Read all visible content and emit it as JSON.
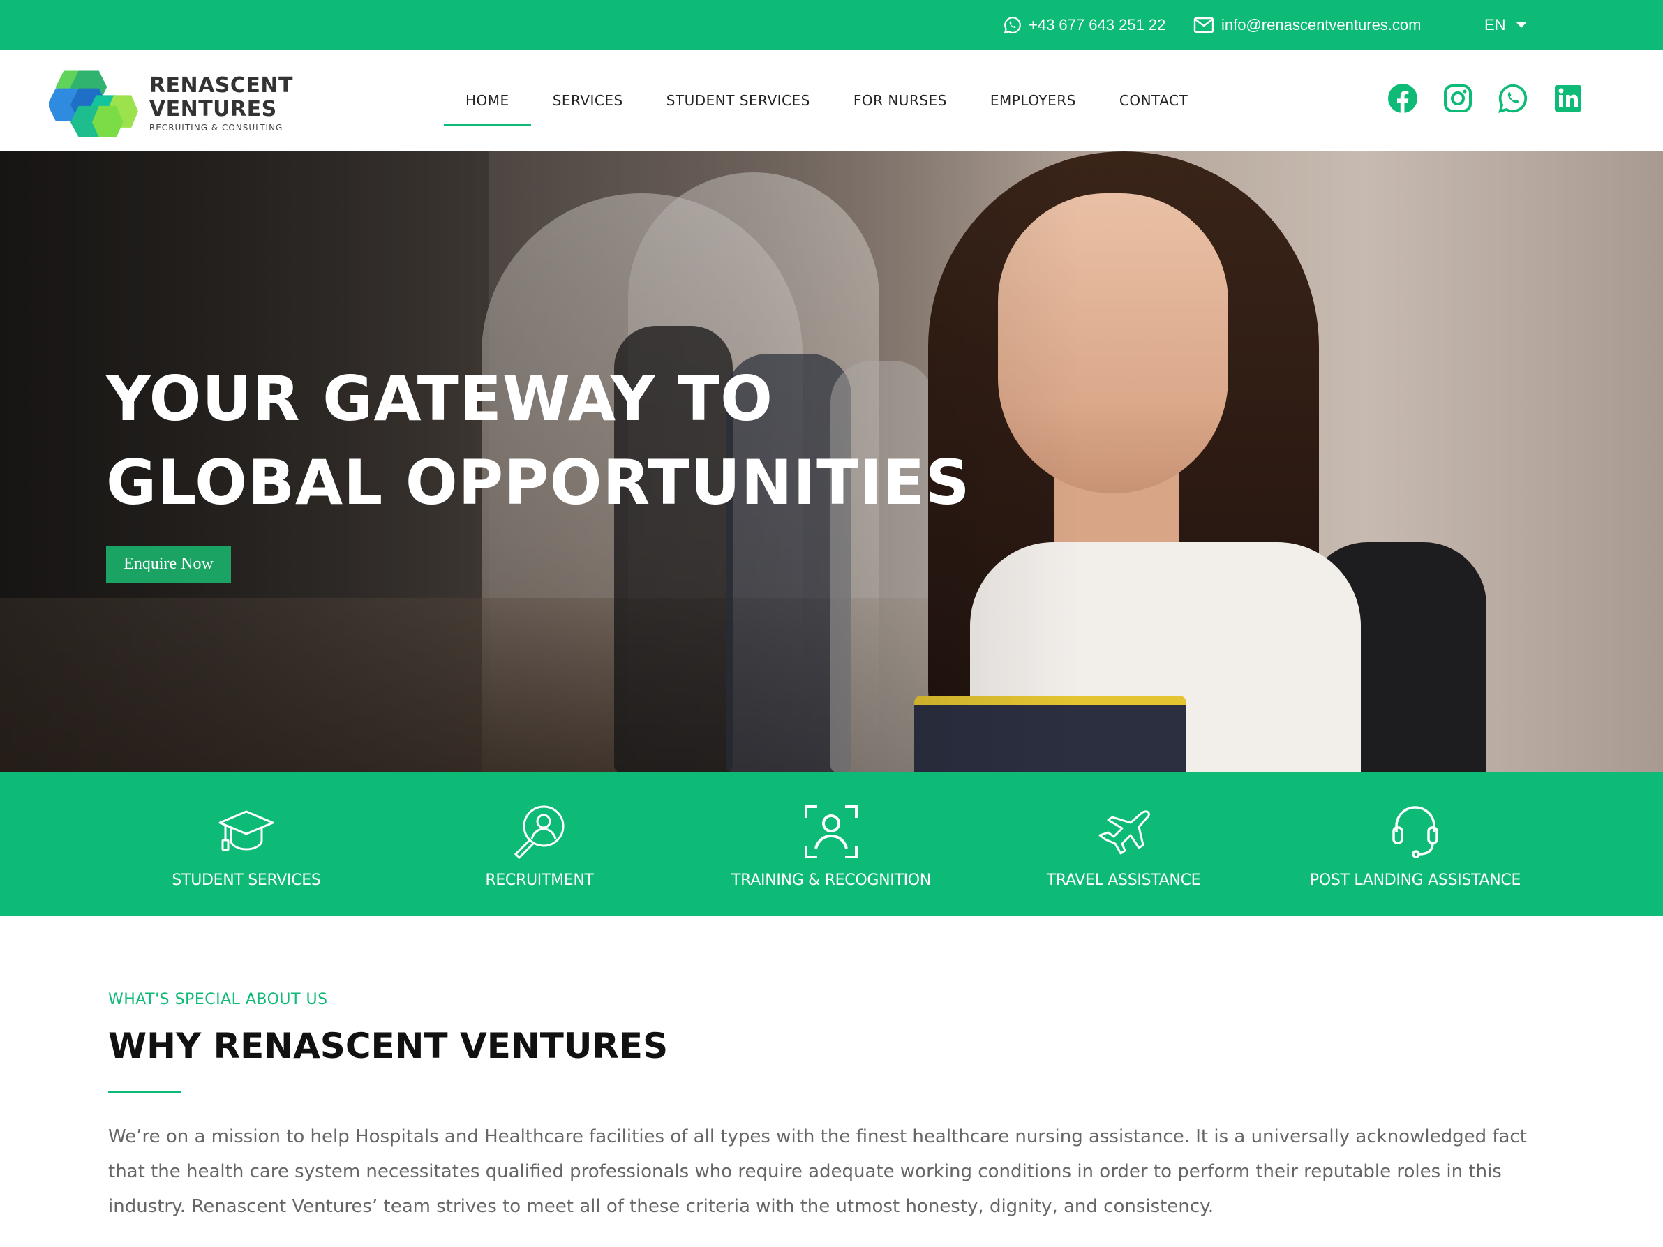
{
  "topbar": {
    "phone": "+43 677 643 251 22",
    "email": "info@renascentventures.com",
    "language": "EN",
    "background": "#0dba76"
  },
  "logo": {
    "line1": "RENASCENT",
    "line2": "VENTURES",
    "tagline": "RECRUITING & CONSULTING"
  },
  "nav": {
    "items": [
      {
        "label": "HOME",
        "active": true
      },
      {
        "label": "SERVICES"
      },
      {
        "label": "STUDENT SERVICES"
      },
      {
        "label": "FOR NURSES"
      },
      {
        "label": "EMPLOYERS"
      },
      {
        "label": "CONTACT"
      }
    ]
  },
  "social": {
    "icons": [
      "facebook-icon",
      "instagram-icon",
      "whatsapp-icon",
      "linkedin-icon"
    ],
    "color": "#0dba76"
  },
  "hero": {
    "title_line1": "YOUR GATEWAY TO",
    "title_line2": "GLOBAL OPPORTUNITIES",
    "cta_label": "Enquire Now",
    "cta_color": "#1aa363"
  },
  "features": [
    {
      "label": "STUDENT SERVICES",
      "icon": "graduation-cap-icon"
    },
    {
      "label": "RECRUITMENT",
      "icon": "search-user-icon"
    },
    {
      "label": "TRAINING & RECOGNITION",
      "icon": "face-scan-icon"
    },
    {
      "label": "TRAVEL ASSISTANCE",
      "icon": "airplane-icon"
    },
    {
      "label": "POST LANDING ASSISTANCE",
      "icon": "headset-icon"
    }
  ],
  "about": {
    "eyebrow": "WHAT'S SPECIAL ABOUT US",
    "title": "WHY RENASCENT VENTURES",
    "body": "We’re on a mission to help Hospitals and Healthcare facilities of all types with the finest healthcare nursing assistance. It is a universally acknowledged fact that the health care system necessitates qualified professionals who require adequate working conditions in order to perform their reputable roles in this industry. Renascent Ventures’ team strives to meet all of these criteria with the utmost honesty, dignity, and consistency."
  }
}
